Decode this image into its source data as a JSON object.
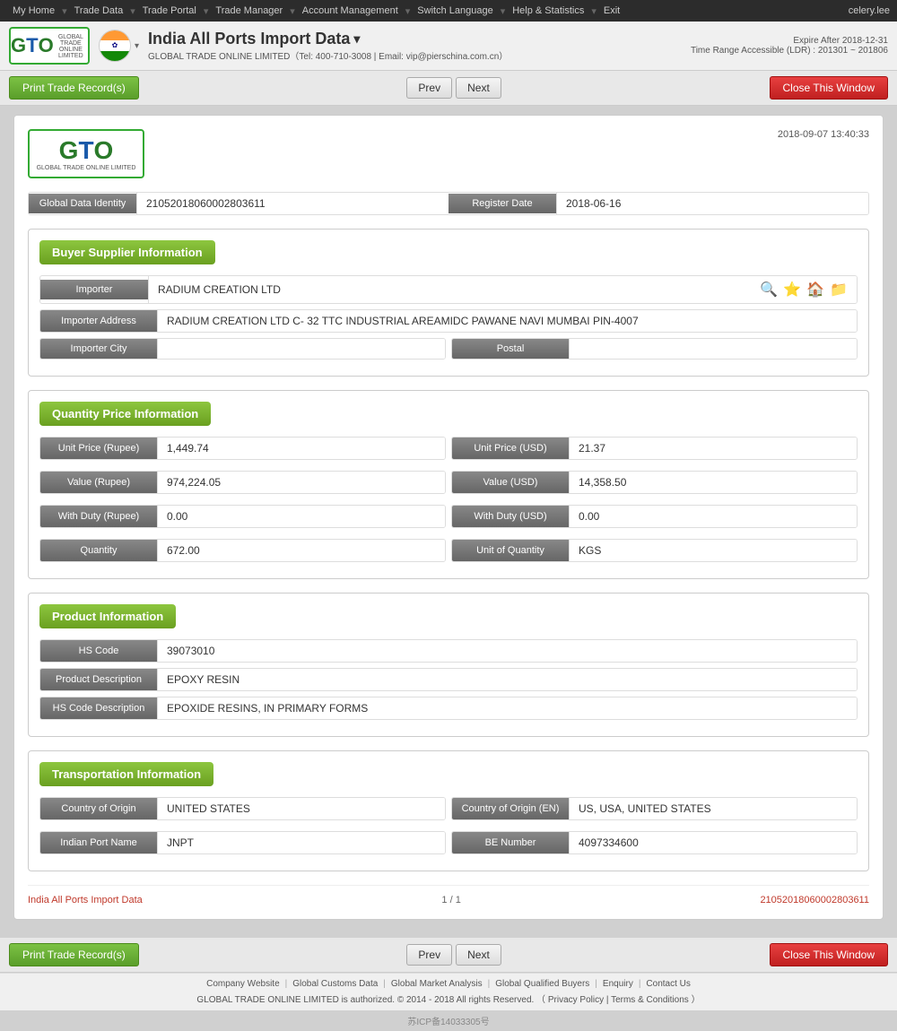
{
  "topnav": {
    "items": [
      "My Home",
      "Trade Data",
      "Trade Portal",
      "Trade Manager",
      "Account Management",
      "Switch Language",
      "Help & Statistics",
      "Exit"
    ],
    "user": "celery.lee"
  },
  "header": {
    "page_title": "India All Ports Import Data",
    "dropdown_arrow": "▾",
    "subtitle": "GLOBAL TRADE ONLINE LIMITED（Tel: 400-710-3008 | Email: vip@pierschina.com.cn）",
    "expire_label": "Expire After 2018-12-31",
    "range_label": "Time Range Accessible (LDR) : 201301 ~ 201806"
  },
  "toolbar": {
    "print_label": "Print Trade Record(s)",
    "prev_label": "Prev",
    "next_label": "Next",
    "close_label": "Close This Window"
  },
  "record": {
    "timestamp": "2018-09-07  13:40:33",
    "global_data_identity_label": "Global Data Identity",
    "global_data_identity_value": "21052018060002803611",
    "register_date_label": "Register Date",
    "register_date_value": "2018-06-16",
    "sections": {
      "buyer_supplier": {
        "title": "Buyer    Supplier Information",
        "importer_label": "Importer",
        "importer_value": "RADIUM CREATION LTD",
        "importer_address_label": "Importer Address",
        "importer_address_value": "RADIUM CREATION LTD C- 32 TTC INDUSTRIAL AREAMIDC PAWANE NAVI MUMBAI PIN-4007",
        "importer_city_label": "Importer City",
        "importer_city_value": "",
        "postal_label": "Postal",
        "postal_value": ""
      },
      "quantity_price": {
        "title": "Quantity    Price Information",
        "unit_price_rupee_label": "Unit Price (Rupee)",
        "unit_price_rupee_value": "1,449.74",
        "unit_price_usd_label": "Unit Price (USD)",
        "unit_price_usd_value": "21.37",
        "value_rupee_label": "Value (Rupee)",
        "value_rupee_value": "974,224.05",
        "value_usd_label": "Value (USD)",
        "value_usd_value": "14,358.50",
        "with_duty_rupee_label": "With Duty (Rupee)",
        "with_duty_rupee_value": "0.00",
        "with_duty_usd_label": "With Duty (USD)",
        "with_duty_usd_value": "0.00",
        "quantity_label": "Quantity",
        "quantity_value": "672.00",
        "unit_of_quantity_label": "Unit of Quantity",
        "unit_of_quantity_value": "KGS"
      },
      "product": {
        "title": "Product Information",
        "hs_code_label": "HS Code",
        "hs_code_value": "39073010",
        "product_description_label": "Product Description",
        "product_description_value": "EPOXY RESIN",
        "hs_code_description_label": "HS Code Description",
        "hs_code_description_value": "EPOXIDE RESINS, IN PRIMARY FORMS"
      },
      "transportation": {
        "title": "Transportation Information",
        "country_of_origin_label": "Country of Origin",
        "country_of_origin_value": "UNITED STATES",
        "country_of_origin_en_label": "Country of Origin (EN)",
        "country_of_origin_en_value": "US, USA, UNITED STATES",
        "indian_port_name_label": "Indian Port Name",
        "indian_port_name_value": "JNPT",
        "be_number_label": "BE Number",
        "be_number_value": "4097334600"
      }
    },
    "footer": {
      "link_text": "India All Ports Import Data",
      "page_info": "1 / 1",
      "record_id": "21052018060002803611"
    }
  },
  "site_footer": {
    "icp": "苏ICP备14033305号",
    "links": [
      "Company Website",
      "Global Customs Data",
      "Global Market Analysis",
      "Global Qualified Buyers",
      "Enquiry",
      "Contact Us"
    ],
    "copyright": "GLOBAL TRADE ONLINE LIMITED is authorized. © 2014 - 2018 All rights Reserved. （",
    "privacy_label": "Privacy Policy",
    "terms_label": "Terms & Conditions",
    "copyright_end": "）"
  },
  "icons": {
    "search": "🔍",
    "star": "⭐",
    "house": "🏠",
    "folder": "📁",
    "dropdown": "▾"
  }
}
